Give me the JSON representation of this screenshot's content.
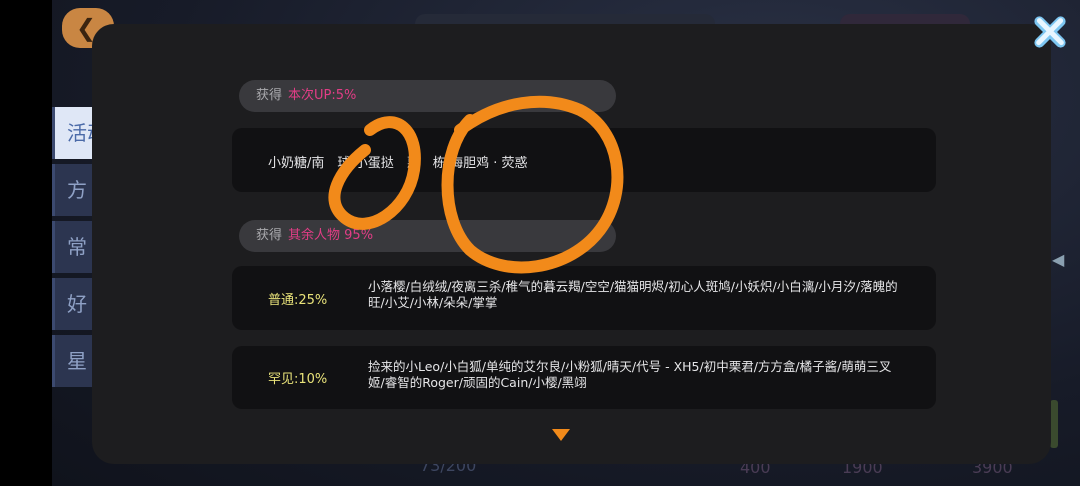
{
  "background": {
    "back_icon": "back-arrow-icon",
    "side_tabs": [
      "活动",
      "方",
      "常",
      "好",
      "星"
    ],
    "bottom_count": "73/200",
    "stats": [
      "400",
      "1900",
      "3900"
    ]
  },
  "close_icon": "close-x-icon",
  "up_section": {
    "label": "获得",
    "highlight": "本次UP:5%",
    "names": "小奶糖/南　球/小蛋挞　惠　栋/海胆鸡 · 荧惑"
  },
  "other_section": {
    "label": "获得",
    "highlight": "其余人物 95%"
  },
  "tiers": [
    {
      "label": "普通:25%",
      "names": "小落樱/白绒绒/夜离三杀/稚气的暮云羯/空空/猫猫明烬/初心人斑鸠/小妖炽/小白漓/小月汐/落魄的旺/小艾/小林/朵朵/掌掌"
    },
    {
      "label": "罕见:10%",
      "names": "捡来的小Leo/小白狐/单纯的艾尔良/小粉狐/晴天/代号 - XH5/初中栗君/方方盒/橘子酱/萌萌三叉姬/睿智的Roger/顽固的Cain/小樱/黑翊"
    },
    {}
  ],
  "scroll_icon": "chevron-down-icon",
  "colors": {
    "modal_bg": "#1d1d1f",
    "highlight": "#e23d86",
    "tier_label": "#e9e37a",
    "annotation": "#f28a1a"
  }
}
